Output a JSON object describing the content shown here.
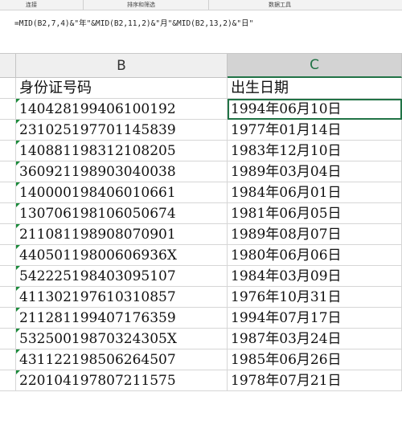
{
  "ribbon": {
    "groups": [
      "连接",
      "排序和筛选",
      "数据工具"
    ]
  },
  "formula_bar": {
    "formula": "=MID(B2,7,4)&\"年\"&MID(B2,11,2)&\"月\"&MID(B2,13,2)&\"日\""
  },
  "columns": {
    "b": "B",
    "c": "C"
  },
  "table": {
    "header_b": "身份证号码",
    "header_c": "出生日期",
    "rows": [
      {
        "id": "140428199406100192",
        "date": "1994年06月10日"
      },
      {
        "id": "231025197701145839",
        "date": "1977年01月14日"
      },
      {
        "id": "140881198312108205",
        "date": "1983年12月10日"
      },
      {
        "id": "360921198903040038",
        "date": "1989年03月04日"
      },
      {
        "id": "140000198406010661",
        "date": "1984年06月01日"
      },
      {
        "id": "130706198106050674",
        "date": "1981年06月05日"
      },
      {
        "id": "211081198908070901",
        "date": "1989年08月07日"
      },
      {
        "id": "44050119800606936X",
        "date": "1980年06月06日"
      },
      {
        "id": "542225198403095107",
        "date": "1984年03月09日"
      },
      {
        "id": "411302197610310857",
        "date": "1976年10月31日"
      },
      {
        "id": "211281199407176359",
        "date": "1994年07月17日"
      },
      {
        "id": "53250019870324305X",
        "date": "1987年03月24日"
      },
      {
        "id": "431122198506264507",
        "date": "1985年06月26日"
      },
      {
        "id": "220104197807211575",
        "date": "1978年07月21日"
      }
    ]
  },
  "colors": {
    "accent": "#217346",
    "error_marker": "#1a8a3a"
  }
}
